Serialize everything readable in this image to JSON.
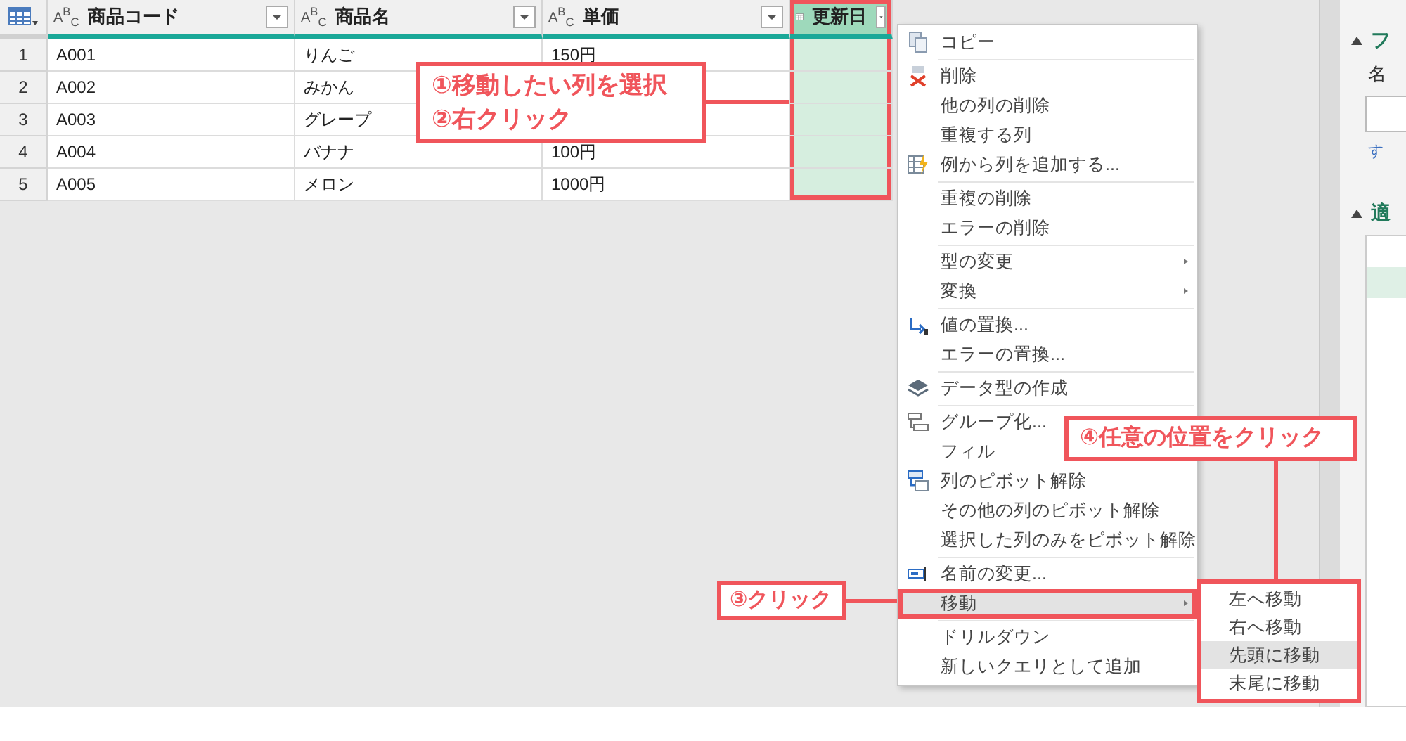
{
  "table": {
    "columns": [
      {
        "name": "商品コード",
        "kind": "text",
        "type_label": "A$^{B}$$_{C}$",
        "selected": false
      },
      {
        "name": "商品名",
        "kind": "text",
        "type_label": "A$^{B}$$_{C}$",
        "selected": false
      },
      {
        "name": "単価",
        "kind": "text",
        "type_label": "A$^{B}$$_{C}$",
        "selected": false
      },
      {
        "name": "更新日",
        "kind": "date",
        "selected": true
      }
    ],
    "rows": [
      {
        "number": "1",
        "cells": [
          "A001",
          "りんご",
          "150円"
        ]
      },
      {
        "number": "2",
        "cells": [
          "A002",
          "みかん"
        ]
      },
      {
        "number": "3",
        "cells": [
          "A003",
          "グレープ"
        ]
      },
      {
        "number": "4",
        "cells": [
          "A004",
          "バナナ",
          "100円"
        ]
      },
      {
        "number": "5",
        "cells": [
          "A005",
          "メロン",
          "1000円"
        ]
      }
    ]
  },
  "context_menu": {
    "groups": [
      [
        {
          "label": "コピー",
          "selected": false
        }
      ],
      [
        {
          "label": "削除",
          "selected": false
        },
        {
          "label": "他の列の削除",
          "selected": false
        },
        {
          "label": "重複する列",
          "selected": false
        },
        {
          "label": "例から列を追加する...",
          "selected": false
        }
      ],
      [
        {
          "label": "重複の削除",
          "selected": false
        },
        {
          "label": "エラーの削除",
          "selected": false
        }
      ],
      [
        {
          "label": "型の変更",
          "selected": false,
          "submenu": true
        },
        {
          "label": "変換",
          "selected": false,
          "submenu": true
        }
      ],
      [
        {
          "label": "値の置換...",
          "selected": false
        },
        {
          "label": "エラーの置換...",
          "selected": false
        }
      ],
      [
        {
          "label": "データ型の作成",
          "selected": false
        }
      ],
      [
        {
          "label": "グループ化...",
          "selected": false
        },
        {
          "label": "フィル",
          "selected": false
        },
        {
          "label": "列のピボット解除",
          "selected": false
        },
        {
          "label": "その他の列のピボット解除",
          "selected": false
        },
        {
          "label": "選択した列のみをピボット解除",
          "selected": false
        }
      ],
      [
        {
          "label": "名前の変更...",
          "selected": false
        },
        {
          "label": "移動",
          "selected": true,
          "submenu": true
        }
      ],
      [
        {
          "label": "ドリルダウン",
          "selected": false
        },
        {
          "label": "新しいクエリとして追加",
          "selected": false
        }
      ]
    ]
  },
  "submenu": {
    "items": [
      {
        "label": "左へ移動",
        "selected": false
      },
      {
        "label": "右へ移動",
        "selected": false
      },
      {
        "label": "先頭に移動",
        "selected": true
      },
      {
        "label": "末尾に移動",
        "selected": false
      }
    ]
  },
  "side_panel": {
    "sections": [
      {
        "title": "フ"
      },
      {
        "title": "適"
      }
    ],
    "name_label": "名",
    "link": "す"
  },
  "annotations": [
    {
      "text": "①移動したい列を選択\n②右クリック"
    },
    {
      "text": "③クリック"
    },
    {
      "text": "④任意の位置をクリック"
    }
  ]
}
